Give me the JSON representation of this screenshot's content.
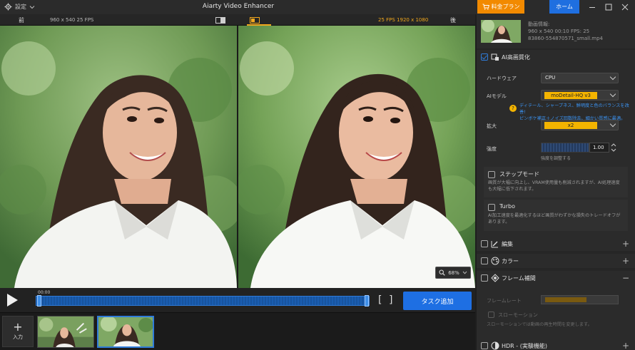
{
  "titlebar": {
    "settings_label": "設定",
    "app_title": "Aiarty Video Enhancer",
    "pricing_label": "料金プラン",
    "home_label": "ホーム"
  },
  "preview": {
    "before_label": "前",
    "after_label": "後",
    "source_info": "960 x 540   25 FPS",
    "output_info": "25 FPS   1920 x 1080",
    "zoom": "68%"
  },
  "timeline": {
    "current_time": "00:00",
    "in_bracket": "[",
    "out_bracket": "]",
    "add_task_label": "タスク追加"
  },
  "bottom": {
    "add_label": "入力"
  },
  "file": {
    "title": "動画情報:",
    "meta": "960 x 540   00:10    FPS: 25",
    "filename": "83860-554870571_small.mp4"
  },
  "ai": {
    "section_label": "AI高画質化",
    "hardware_label": "ハードウェア",
    "hardware_value": "CPU",
    "model_label": "AIモデル",
    "model_value": "moDetail-HQ  v3",
    "hint_line1": "ディテール、シャープネス、鮮明度と色のバランスを改善!",
    "hint_line2": "ピンボケ補正＋ノイズ回数除去、細かい質感に最適。",
    "scale_label": "拡大",
    "scale_value": "x2",
    "strength_label": "強度",
    "strength_value": "1.00",
    "strength_hint": "強度を調整する",
    "step_mode_label": "ステップモード",
    "step_mode_desc": "画質が大幅に向上し、VRAM使用量も削減されますが、AI処理速度も大幅に低下されます。",
    "turbo_label": "Turbo",
    "turbo_desc": "AI加工速度を最適化するほど画質がわずかな損失のトレードオフがあります。"
  },
  "sections": {
    "edit_label": "編集",
    "color_label": "カラー",
    "frame_label": "フレーム補間",
    "frame_rate_label": "フレームレート",
    "slow_motion_label": "スローモーション",
    "slow_motion_desc": "スローモーションでは動画の再生時間を変更します。",
    "hdr_label": "HDR - (実験機能)"
  }
}
